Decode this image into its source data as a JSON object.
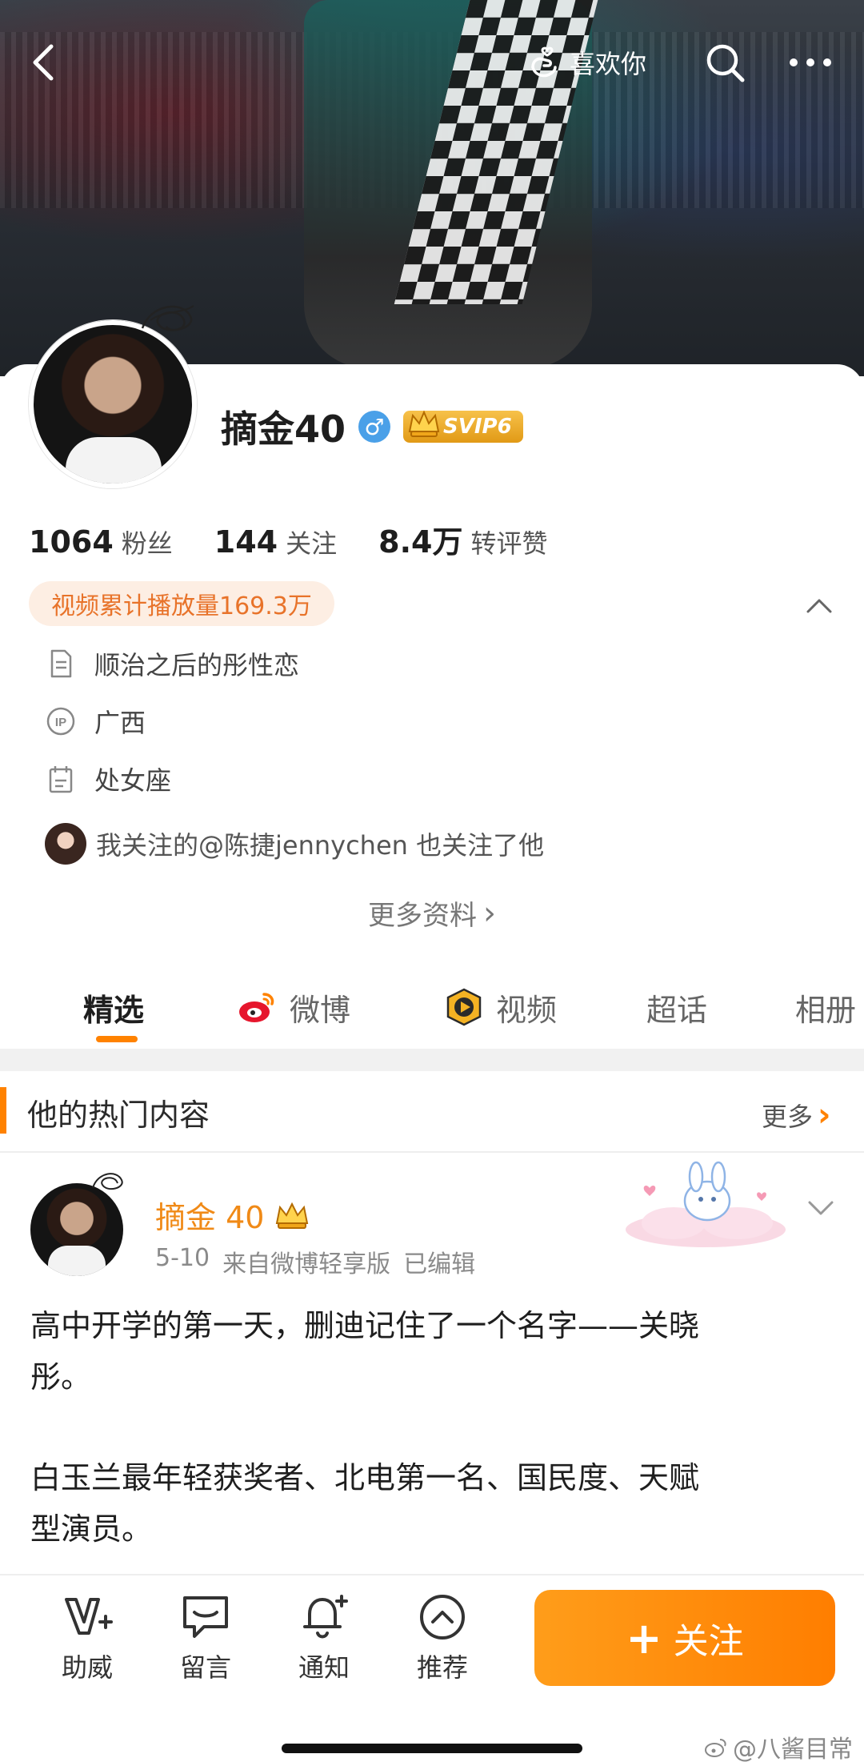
{
  "topbar": {
    "like_label": "喜欢你"
  },
  "profile": {
    "name": "摘金40",
    "gender_symbol": "♂",
    "vip_label": "SVIP6",
    "stats": [
      {
        "num": "1064",
        "label": "粉丝"
      },
      {
        "num": "144",
        "label": "关注"
      },
      {
        "num": "8.4万",
        "label": "转评赞"
      }
    ],
    "video_tag": "视频累计播放量169.3万",
    "bio": "顺治之后的彤性恋",
    "ip_location": "广西",
    "zodiac": "处女座",
    "mutual_follow": "我关注的@陈捷jennychen 也关注了他",
    "more_info": "更多资料",
    "more_info_chevron": "›"
  },
  "tabs": [
    {
      "label": "精选",
      "active": true
    },
    {
      "label": "微博",
      "icon": "weibo-icon"
    },
    {
      "label": "视频",
      "icon": "video-icon"
    },
    {
      "label": "超话"
    },
    {
      "label": "相册"
    }
  ],
  "hot_section": {
    "title": "他的热门内容",
    "more": "更多",
    "more_chevron": "›"
  },
  "post": {
    "author": "摘金 40",
    "date": "5-10",
    "source": "来自微博轻享版",
    "edited": "已编辑",
    "paragraph_1_line_1": "高中开学的第一天，删迪记住了一个名字——关晓",
    "paragraph_1_line_2": "彤。",
    "paragraph_2_line_1": "白玉兰最年轻获奖者、北电第一名、国民度、天赋",
    "paragraph_2_line_2": "型演员。"
  },
  "bottom_bar": {
    "items": [
      {
        "label": "助威",
        "icon": "cheer-icon"
      },
      {
        "label": "留言",
        "icon": "comment-icon"
      },
      {
        "label": "通知",
        "icon": "bell-plus-icon"
      },
      {
        "label": "推荐",
        "icon": "recommend-icon"
      }
    ],
    "follow_plus": "+",
    "follow_label": "关注"
  },
  "watermark": "@八酱目常",
  "colors": {
    "accent": "#ff8200",
    "author_name": "#f08a17",
    "video_tag_bg": "#fdeee3",
    "gender_badge": "#4aa0e8"
  }
}
